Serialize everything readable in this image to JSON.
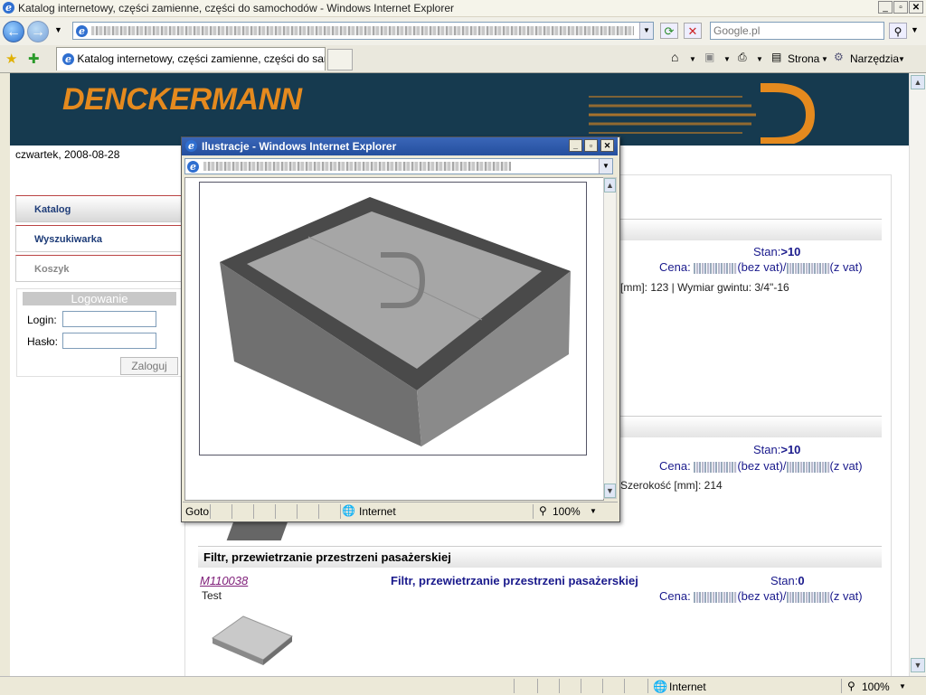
{
  "window": {
    "title": "Katalog internetowy, części zamienne, części do samochodów - Windows Internet Explorer",
    "search_placeholder": "Google.pl",
    "tab_label": "Katalog internetowy, części zamienne, części do samo...",
    "toolbar": {
      "page_label": "Strona",
      "tools_label": "Narzędzia"
    },
    "status": {
      "zone": "Internet",
      "zoom": "100%"
    }
  },
  "site": {
    "logo": "DENCKERMANN",
    "date": "czwartek, 2008-08-28",
    "menu": [
      {
        "label": "Katalog",
        "color": "#1e3c78"
      },
      {
        "label": "Wyszukiwarka",
        "color": "#1e3c78"
      },
      {
        "label": "Koszyk",
        "color": "#888888"
      }
    ],
    "login": {
      "title": "Logowanie",
      "login_label": "Login:",
      "password_label": "Hasło:",
      "submit": "Zaloguj"
    }
  },
  "products": {
    "row1": {
      "stan_label": "Stan:",
      "stan_value": ">10",
      "cena_label": "Cena:",
      "net_label": "(bez vat)/",
      "gross_label": "(z vat)",
      "spec": "[mm]: 123 | Wymiar gwintu: 3/4\"-16"
    },
    "row2": {
      "stan_label": "Stan:",
      "stan_value": ">10",
      "cena_label": "Cena:",
      "net_label": "(bez vat)/",
      "gross_label": "(z vat)",
      "spec": "Szerokość [mm]: 214"
    },
    "row3": {
      "section_title": "Filtr, przewietrzanie przestrzeni pasażerskiej",
      "code": "M110038",
      "name": "Filtr, przewietrzanie przestrzeni pasażerskiej",
      "desc": "Test",
      "stan_label": "Stan:",
      "stan_value": "0",
      "cena_label": "Cena:",
      "net_label": "(bez vat)/",
      "gross_label": "(z vat)"
    }
  },
  "popup": {
    "title": "Ilustracje - Windows Internet Explorer",
    "status_text": "Goto",
    "zone": "Internet",
    "zoom": "100%"
  },
  "colors": {
    "banner": "#163a4f",
    "logo": "#e58a1e",
    "link": "#1a1a8c",
    "visited": "#80207a"
  }
}
